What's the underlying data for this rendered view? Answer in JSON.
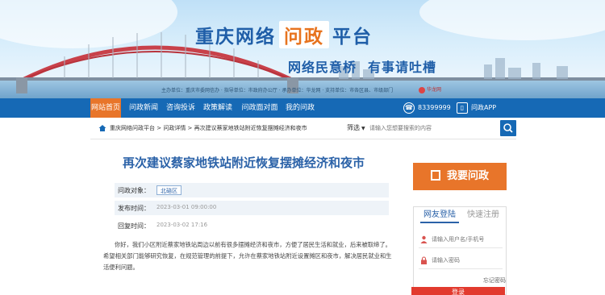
{
  "banner": {
    "title_prefix": "重庆网络",
    "title_highlight": "问政",
    "title_suffix": "平台",
    "slogan_1": "网络民意桥",
    "slogan_2": "有事请吐槽",
    "sponsors": "主办单位：重庆市委网信办 · 指导单位：市政府办公厅 · 承办单位：华龙网 · 支持单位：市各区县、市级部门",
    "sponsor_logo": "华龙网"
  },
  "nav": {
    "items": [
      "网站首页",
      "问政新闻",
      "咨询投诉",
      "政策解读",
      "问政面对面",
      "我的问政"
    ],
    "active_index": 0,
    "tool_1": "83399999",
    "tool_2": "问政APP"
  },
  "breadcrumb": {
    "text": "重庆网络问政平台 > 问政详情 > 再次建议蔡家地铁站附近恢复摆摊经济和夜市"
  },
  "search": {
    "select_label": "筛选",
    "placeholder": "请输入您想要搜索的内容"
  },
  "article": {
    "title": "再次建议蔡家地铁站附近恢复摆摊经济和夜市",
    "meta": {
      "target_label": "问政对象：",
      "target_value": "北碚区",
      "time_label": "发布时间：",
      "time_value": "2023-03-01 09:00:00",
      "reply_label": "回复时间：",
      "reply_value": "2023-03-02 17:16"
    },
    "body": "你好，我们小区附近蔡家地铁站周边以前有很多摆摊经济和夜市，方便了居民生活和就业，后来被取缔了。希望相关部门能够研究恢复，在规范管理的前提下，允许在蔡家地铁站附近设置摊区和夜市，解决居民就业和生活便利问题。"
  },
  "sidebar": {
    "ask_label": "我要问政",
    "tab_active": "网友登陆",
    "tab_inactive": "快速注册",
    "username_placeholder": "请输入用户名/手机号",
    "password_placeholder": "请输入密码",
    "register_link": "忘记密码",
    "submit_label": "登录"
  },
  "colors": {
    "brand_blue": "#1669b5",
    "accent_orange": "#e8752a",
    "title_blue": "#2b62a8",
    "submit_red": "#e23a2e"
  }
}
